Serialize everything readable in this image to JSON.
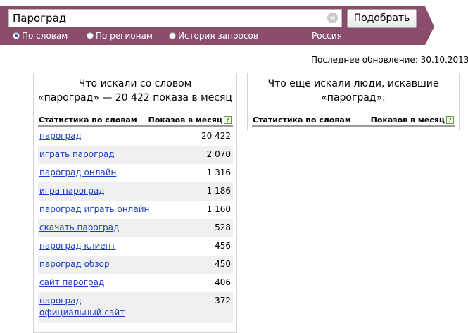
{
  "search": {
    "query": "Пароград",
    "submit_label": "Подобрать",
    "options": [
      {
        "label": "По словам",
        "checked": true
      },
      {
        "label": "По регионам",
        "checked": false
      },
      {
        "label": "История запросов",
        "checked": false
      }
    ],
    "region": "Россия"
  },
  "last_update": "Последнее обновление: 30.10.2013",
  "left_panel": {
    "title_line1": "Что искали со словом",
    "title_line2": "«пароград» — 20 422 показа в месяц",
    "col_phrase": "Статистика по словам",
    "col_count": "Показов в месяц",
    "rows": [
      {
        "phrase": "пароград",
        "count": "20 422"
      },
      {
        "phrase": "играть пароград",
        "count": "2 070"
      },
      {
        "phrase": "пароград онлайн",
        "count": "1 316"
      },
      {
        "phrase": "игра пароград",
        "count": "1 186"
      },
      {
        "phrase": "пароград играть онлайн",
        "count": "1 160"
      },
      {
        "phrase": "скачать пароград",
        "count": "528"
      },
      {
        "phrase": "пароград клиент",
        "count": "456"
      },
      {
        "phrase": "пароград обзор",
        "count": "450"
      },
      {
        "phrase": "сайт пароград",
        "count": "406"
      },
      {
        "phrase": "пароград официальный сайт",
        "count": "372"
      }
    ]
  },
  "right_panel": {
    "title_line1": "Что еще искали люди, искавшие",
    "title_line2": "«пароград»:",
    "col_phrase": "Статистика по словам",
    "col_count": "Показов в месяц"
  },
  "icons": {
    "help": "help-icon",
    "clear": "clear-icon",
    "radio": "radio-icon"
  },
  "colors": {
    "bar": "#8b4d6b",
    "link": "#1a3dc1",
    "alt_row": "#f0f0f0"
  }
}
